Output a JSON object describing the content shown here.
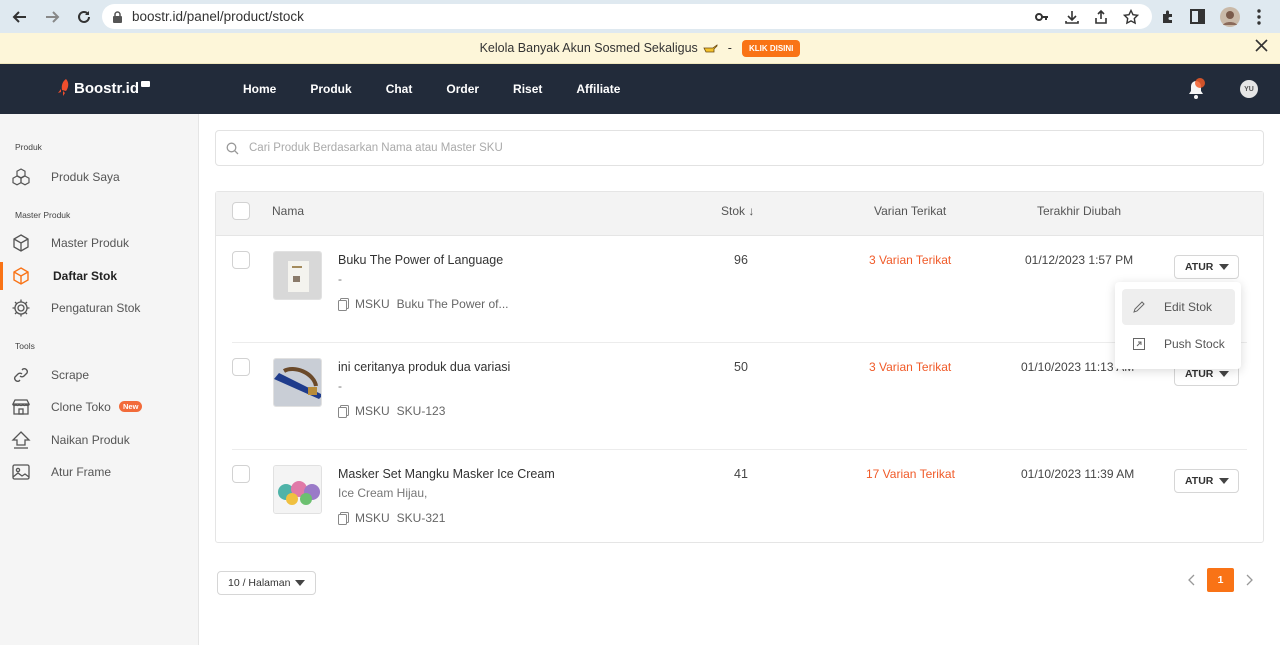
{
  "browser": {
    "url_host": "boostr.id",
    "url_path": "/panel/product/stock"
  },
  "promo": {
    "text": "Kelola Banyak Akun Sosmed Sekaligus",
    "separator": "-",
    "cta": "KLIK DISINI"
  },
  "header": {
    "logo": "Boostr.id",
    "nav": [
      "Home",
      "Produk",
      "Chat",
      "Order",
      "Riset",
      "Affiliate"
    ],
    "avatar": "YU"
  },
  "sidebar": {
    "sections": [
      "Produk",
      "Master Produk",
      "Tools"
    ],
    "items": [
      {
        "label": "Produk Saya",
        "icon": "products-icon"
      },
      {
        "label": "Master Produk",
        "icon": "box-icon"
      },
      {
        "label": "Daftar Stok",
        "icon": "box-icon",
        "active": true
      },
      {
        "label": "Pengaturan Stok",
        "icon": "gear-icon"
      },
      {
        "label": "Scrape",
        "icon": "link-icon"
      },
      {
        "label": "Clone Toko",
        "icon": "store-icon",
        "badge": "New"
      },
      {
        "label": "Naikan Produk",
        "icon": "arrow-up-icon"
      },
      {
        "label": "Atur Frame",
        "icon": "image-icon"
      }
    ]
  },
  "search": {
    "placeholder": "Cari Produk Berdasarkan Nama atau Master SKU"
  },
  "table": {
    "columns": [
      "Nama",
      "Stok ↓",
      "Varian Terikat",
      "Terakhir Diubah"
    ],
    "rows": [
      {
        "name": "Buku The Power of Language",
        "variant": "-",
        "sku_label": "MSKU",
        "sku": "Buku The Power of...",
        "stock": "96",
        "linked": "3 Varian Terikat",
        "updated": "01/12/2023 1:57 PM",
        "action": "ATUR"
      },
      {
        "name": "ini ceritanya produk dua variasi",
        "variant": "-",
        "sku_label": "MSKU",
        "sku": "SKU-123",
        "stock": "50",
        "linked": "3 Varian Terikat",
        "updated": "01/10/2023 11:13 AM",
        "action": "ATUR"
      },
      {
        "name": "Masker Set Mangku Masker Ice Cream",
        "variant": "Ice Cream Hijau,",
        "sku_label": "MSKU",
        "sku": "SKU-321",
        "stock": "41",
        "linked": "17 Varian Terikat",
        "updated": "01/10/2023 11:39 AM",
        "action": "ATUR"
      }
    ]
  },
  "dropdown": {
    "items": [
      "Edit Stok",
      "Push Stock"
    ]
  },
  "pagination": {
    "page_size": "10 / Halaman",
    "current_page": "1"
  },
  "colors": {
    "accent": "#f97316",
    "header_bg": "#222b3a",
    "link": "#f05a28"
  }
}
